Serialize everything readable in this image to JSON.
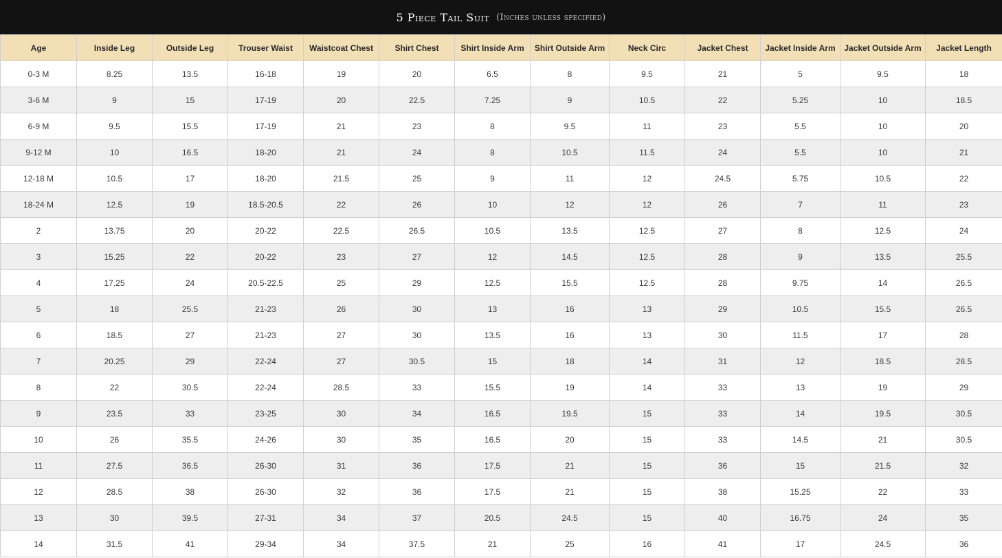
{
  "header": {
    "title": "5 Piece Tail Suit",
    "subtitle": "(Inches unless specified)"
  },
  "table": {
    "columns": [
      "Age",
      "Inside Leg",
      "Outside Leg",
      "Trouser Waist",
      "Waistcoat Chest",
      "Shirt Chest",
      "Shirt Inside Arm",
      "Shirt Outside Arm",
      "Neck Circ",
      "Jacket Chest",
      "Jacket Inside Arm",
      "Jacket Outside Arm",
      "Jacket Length"
    ],
    "rows": [
      [
        "0-3 M",
        "8.25",
        "13.5",
        "16-18",
        "19",
        "20",
        "6.5",
        "8",
        "9.5",
        "21",
        "5",
        "9.5",
        "18"
      ],
      [
        "3-6 M",
        "9",
        "15",
        "17-19",
        "20",
        "22.5",
        "7.25",
        "9",
        "10.5",
        "22",
        "5.25",
        "10",
        "18.5"
      ],
      [
        "6-9 M",
        "9.5",
        "15.5",
        "17-19",
        "21",
        "23",
        "8",
        "9.5",
        "11",
        "23",
        "5.5",
        "10",
        "20"
      ],
      [
        "9-12 M",
        "10",
        "16.5",
        "18-20",
        "21",
        "24",
        "8",
        "10.5",
        "11.5",
        "24",
        "5.5",
        "10",
        "21"
      ],
      [
        "12-18 M",
        "10.5",
        "17",
        "18-20",
        "21.5",
        "25",
        "9",
        "11",
        "12",
        "24.5",
        "5.75",
        "10.5",
        "22"
      ],
      [
        "18-24 M",
        "12.5",
        "19",
        "18.5-20.5",
        "22",
        "26",
        "10",
        "12",
        "12",
        "26",
        "7",
        "11",
        "23"
      ],
      [
        "2",
        "13.75",
        "20",
        "20-22",
        "22.5",
        "26.5",
        "10.5",
        "13.5",
        "12.5",
        "27",
        "8",
        "12.5",
        "24"
      ],
      [
        "3",
        "15.25",
        "22",
        "20-22",
        "23",
        "27",
        "12",
        "14.5",
        "12.5",
        "28",
        "9",
        "13.5",
        "25.5"
      ],
      [
        "4",
        "17.25",
        "24",
        "20.5-22.5",
        "25",
        "29",
        "12.5",
        "15.5",
        "12.5",
        "28",
        "9.75",
        "14",
        "26.5"
      ],
      [
        "5",
        "18",
        "25.5",
        "21-23",
        "26",
        "30",
        "13",
        "16",
        "13",
        "29",
        "10.5",
        "15.5",
        "26.5"
      ],
      [
        "6",
        "18.5",
        "27",
        "21-23",
        "27",
        "30",
        "13.5",
        "16",
        "13",
        "30",
        "11.5",
        "17",
        "28"
      ],
      [
        "7",
        "20.25",
        "29",
        "22-24",
        "27",
        "30.5",
        "15",
        "18",
        "14",
        "31",
        "12",
        "18.5",
        "28.5"
      ],
      [
        "8",
        "22",
        "30.5",
        "22-24",
        "28.5",
        "33",
        "15.5",
        "19",
        "14",
        "33",
        "13",
        "19",
        "29"
      ],
      [
        "9",
        "23.5",
        "33",
        "23-25",
        "30",
        "34",
        "16.5",
        "19.5",
        "15",
        "33",
        "14",
        "19.5",
        "30.5"
      ],
      [
        "10",
        "26",
        "35.5",
        "24-26",
        "30",
        "35",
        "16.5",
        "20",
        "15",
        "33",
        "14.5",
        "21",
        "30.5"
      ],
      [
        "11",
        "27.5",
        "36.5",
        "26-30",
        "31",
        "36",
        "17.5",
        "21",
        "15",
        "36",
        "15",
        "21.5",
        "32"
      ],
      [
        "12",
        "28.5",
        "38",
        "26-30",
        "32",
        "36",
        "17.5",
        "21",
        "15",
        "38",
        "15.25",
        "22",
        "33"
      ],
      [
        "13",
        "30",
        "39.5",
        "27-31",
        "34",
        "37",
        "20.5",
        "24.5",
        "15",
        "40",
        "16.75",
        "24",
        "35"
      ],
      [
        "14",
        "31.5",
        "41",
        "29-34",
        "34",
        "37.5",
        "21",
        "25",
        "16",
        "41",
        "17",
        "24.5",
        "36"
      ]
    ]
  },
  "colors": {
    "header_bg": "#121212",
    "column_header_bg": "#f2dfb6",
    "stripe_bg": "#eeeeee"
  }
}
